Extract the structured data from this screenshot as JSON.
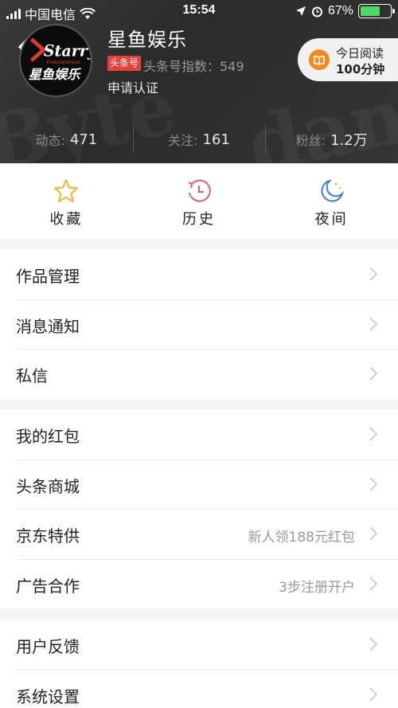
{
  "status_bar": {
    "carrier": "中国电信",
    "time": "15:54",
    "battery": "67%",
    "battery_level": 0.67
  },
  "profile": {
    "name": "星鱼娱乐",
    "badge": "头条号",
    "index_label": "头条号指数：549",
    "verify": "申请认证",
    "avatar_logo_text": "Starry",
    "avatar_logo_sub": "Entertainment",
    "avatar_logo_cn": "星鱼娱乐"
  },
  "reading": {
    "line1": "今日阅读",
    "line2": "100分钟"
  },
  "stats": [
    {
      "label": "动态:",
      "value": "471"
    },
    {
      "label": "关注:",
      "value": "161"
    },
    {
      "label": "粉丝:",
      "value": "1.2万"
    }
  ],
  "quick_actions": [
    {
      "label": "收藏",
      "icon": "star-icon"
    },
    {
      "label": "历史",
      "icon": "clock-icon"
    },
    {
      "label": "夜间",
      "icon": "moon-icon"
    }
  ],
  "menu_groups": [
    [
      {
        "label": "作品管理"
      },
      {
        "label": "消息通知"
      },
      {
        "label": "私信"
      }
    ],
    [
      {
        "label": "我的红包"
      },
      {
        "label": "头条商城"
      },
      {
        "label": "京东特供",
        "hint": "新人领188元红包"
      },
      {
        "label": "广告合作",
        "hint": "3步注册开户"
      }
    ],
    [
      {
        "label": "用户反馈"
      },
      {
        "label": "系统设置"
      }
    ]
  ],
  "colors": {
    "accent_red": "#e8403a",
    "reading_orange": "#f08c1a",
    "star_yellow": "#f2b431",
    "history_pink": "#e05a7a",
    "moon_blue": "#3d7bd9"
  }
}
